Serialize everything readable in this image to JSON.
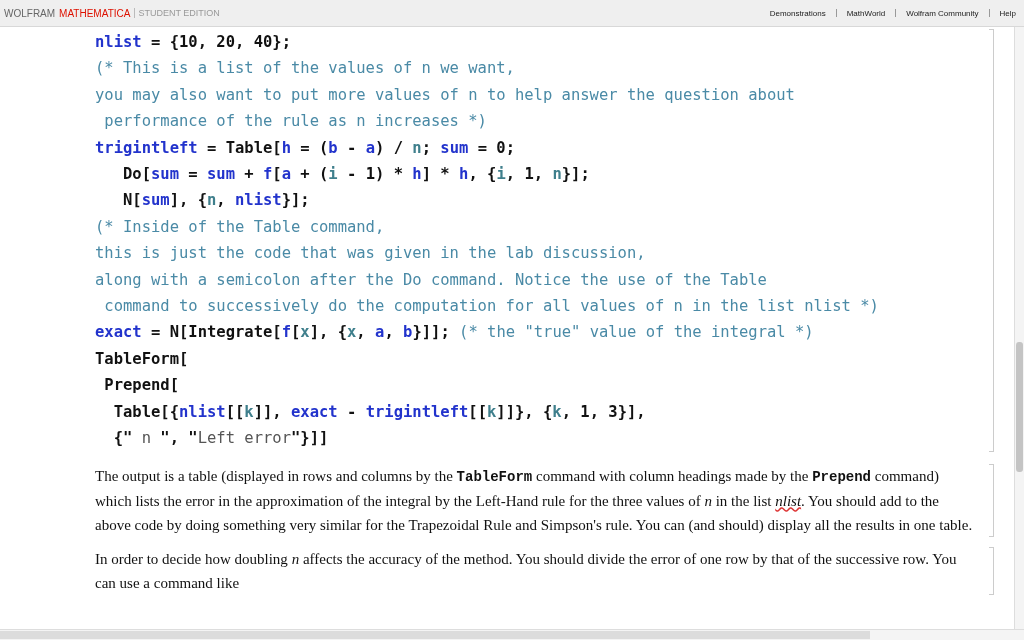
{
  "header": {
    "brand": [
      {
        "text": "WOLFRAM",
        "kind": "plain"
      },
      {
        "text": "MATHEMATICA",
        "kind": "accent"
      }
    ],
    "edition": "STUDENT EDITION",
    "links": [
      "Demonstrations",
      "MathWorld",
      "Wolfram Community",
      "Help"
    ]
  },
  "code": [
    [
      {
        "text": "nlist",
        "kind": "var"
      },
      {
        "text": " = {10, 20, 40};",
        "kind": "plain"
      }
    ],
    [
      {
        "text": "(* This is a list of the values of n we want,",
        "kind": "comment"
      }
    ],
    [
      {
        "text": "you may also want to put more values of n to help answer the question about",
        "kind": "comment"
      }
    ],
    [
      {
        "text": " performance of the rule as n increases *)",
        "kind": "comment"
      }
    ],
    [
      {
        "text": "trigintleft",
        "kind": "var"
      },
      {
        "text": " = Table[",
        "kind": "plain"
      },
      {
        "text": "h",
        "kind": "var"
      },
      {
        "text": " = (",
        "kind": "plain"
      },
      {
        "text": "b",
        "kind": "var"
      },
      {
        "text": " - ",
        "kind": "plain"
      },
      {
        "text": "a",
        "kind": "var"
      },
      {
        "text": ") / ",
        "kind": "plain"
      },
      {
        "text": "n",
        "kind": "param"
      },
      {
        "text": "; ",
        "kind": "plain"
      },
      {
        "text": "sum",
        "kind": "var"
      },
      {
        "text": " = 0;",
        "kind": "plain"
      }
    ],
    [
      {
        "text": "   Do[",
        "kind": "plain"
      },
      {
        "text": "sum",
        "kind": "var"
      },
      {
        "text": " = ",
        "kind": "plain"
      },
      {
        "text": "sum",
        "kind": "var"
      },
      {
        "text": " + ",
        "kind": "plain"
      },
      {
        "text": "f",
        "kind": "var"
      },
      {
        "text": "[",
        "kind": "plain"
      },
      {
        "text": "a",
        "kind": "var"
      },
      {
        "text": " + (",
        "kind": "plain"
      },
      {
        "text": "i",
        "kind": "param"
      },
      {
        "text": " - 1) * ",
        "kind": "plain"
      },
      {
        "text": "h",
        "kind": "var"
      },
      {
        "text": "] * ",
        "kind": "plain"
      },
      {
        "text": "h",
        "kind": "var"
      },
      {
        "text": ", {",
        "kind": "plain"
      },
      {
        "text": "i",
        "kind": "param"
      },
      {
        "text": ", 1, ",
        "kind": "plain"
      },
      {
        "text": "n",
        "kind": "param"
      },
      {
        "text": "}];",
        "kind": "plain"
      }
    ],
    [
      {
        "text": "   N[",
        "kind": "plain"
      },
      {
        "text": "sum",
        "kind": "var"
      },
      {
        "text": "], {",
        "kind": "plain"
      },
      {
        "text": "n",
        "kind": "param"
      },
      {
        "text": ", ",
        "kind": "plain"
      },
      {
        "text": "nlist",
        "kind": "var"
      },
      {
        "text": "}];",
        "kind": "plain"
      }
    ],
    [
      {
        "text": "(* Inside of the Table command,",
        "kind": "comment"
      }
    ],
    [
      {
        "text": "this is just the code that was given in the lab discussion,",
        "kind": "comment"
      }
    ],
    [
      {
        "text": "along with a semicolon after the Do command. Notice the use of the Table",
        "kind": "comment"
      }
    ],
    [
      {
        "text": " command to successively do the computation for all values of n in the list nlist *)",
        "kind": "comment"
      }
    ],
    [
      {
        "text": "exact",
        "kind": "var"
      },
      {
        "text": " = N[Integrate[",
        "kind": "plain"
      },
      {
        "text": "f",
        "kind": "var"
      },
      {
        "text": "[",
        "kind": "plain"
      },
      {
        "text": "x",
        "kind": "param"
      },
      {
        "text": "], {",
        "kind": "plain"
      },
      {
        "text": "x",
        "kind": "param"
      },
      {
        "text": ", ",
        "kind": "plain"
      },
      {
        "text": "a",
        "kind": "var"
      },
      {
        "text": ", ",
        "kind": "plain"
      },
      {
        "text": "b",
        "kind": "var"
      },
      {
        "text": "}]]; ",
        "kind": "plain"
      },
      {
        "text": "(* the \"true\" value of the integral *)",
        "kind": "comment"
      }
    ],
    [
      {
        "text": "TableForm[",
        "kind": "plain"
      }
    ],
    [
      {
        "text": " Prepend[",
        "kind": "plain"
      }
    ],
    [
      {
        "text": "  Table[{",
        "kind": "plain"
      },
      {
        "text": "nlist",
        "kind": "var"
      },
      {
        "text": "[[",
        "kind": "plain"
      },
      {
        "text": "k",
        "kind": "param"
      },
      {
        "text": "]], ",
        "kind": "plain"
      },
      {
        "text": "exact",
        "kind": "var"
      },
      {
        "text": " - ",
        "kind": "plain"
      },
      {
        "text": "trigintleft",
        "kind": "var"
      },
      {
        "text": "[[",
        "kind": "plain"
      },
      {
        "text": "k",
        "kind": "param"
      },
      {
        "text": "]]}, {",
        "kind": "plain"
      },
      {
        "text": "k",
        "kind": "param"
      },
      {
        "text": ", 1, 3}],",
        "kind": "plain"
      }
    ],
    [
      {
        "text": "  {\"",
        "kind": "plain"
      },
      {
        "text": " n ",
        "kind": "string"
      },
      {
        "text": "\", \"",
        "kind": "plain"
      },
      {
        "text": "Left error",
        "kind": "string"
      },
      {
        "text": "\"}]]",
        "kind": "plain"
      }
    ]
  ],
  "paragraphs": [
    [
      {
        "text": "The output is a table (displayed in rows and columns by the ",
        "kind": "text"
      },
      {
        "text": "TableForm",
        "kind": "code"
      },
      {
        "text": " command with column headings made by the ",
        "kind": "text"
      },
      {
        "text": "Prepend",
        "kind": "code"
      },
      {
        "text": " command) which lists the error in the approximation of the integral by the Left-Hand rule for the three values of ",
        "kind": "text"
      },
      {
        "text": "n",
        "kind": "italic"
      },
      {
        "text": " in the list ",
        "kind": "text"
      },
      {
        "text": "nlist",
        "kind": "misspelled"
      },
      {
        "text": ". You should add to the above code by doing something very similar for the Trapezoidal Rule and Simpson's rule. You can (and should) display all the results in one table.",
        "kind": "text"
      }
    ],
    [
      {
        "text": "In order to decide how doubling ",
        "kind": "text"
      },
      {
        "text": "n",
        "kind": "italic"
      },
      {
        "text": " affects the accuracy of the method. You should divide the error of one row by that of the successive row. You can use a command like",
        "kind": "text"
      }
    ]
  ]
}
